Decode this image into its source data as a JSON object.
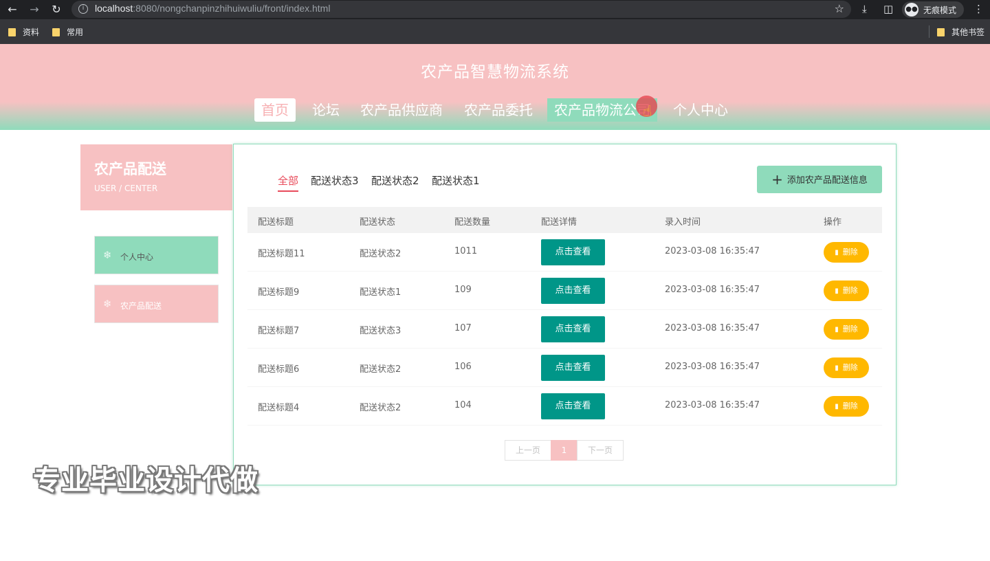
{
  "browser": {
    "url_host": "localhost",
    "url_rest": ":8080/nongchanpinzhihuiwuliu/front/index.html",
    "incognito_label": "无痕模式",
    "bookmarks": [
      "资料",
      "常用"
    ],
    "other_bookmarks": "其他书签"
  },
  "site": {
    "title": "农产品智慧物流系统",
    "nav": [
      "首页",
      "论坛",
      "农产品供应商",
      "农产品委托",
      "农产品物流公司",
      "个人中心"
    ]
  },
  "sidebar": {
    "title": "农产品配送",
    "subtitle": "USER / CENTER",
    "items": [
      "个人中心",
      "农产品配送"
    ]
  },
  "main": {
    "filters": [
      "全部",
      "配送状态3",
      "配送状态2",
      "配送状态1"
    ],
    "add_button": "添加农产品配送信息",
    "columns": [
      "配送标题",
      "配送状态",
      "配送数量",
      "配送详情",
      "录入时间",
      "操作"
    ],
    "rows": [
      {
        "title": "配送标题11",
        "status": "配送状态2",
        "qty": "1011",
        "view": "点击查看",
        "time": "2023-03-08 16:35:47",
        "del": "删除"
      },
      {
        "title": "配送标题9",
        "status": "配送状态1",
        "qty": "109",
        "view": "点击查看",
        "time": "2023-03-08 16:35:47",
        "del": "删除"
      },
      {
        "title": "配送标题7",
        "status": "配送状态3",
        "qty": "107",
        "view": "点击查看",
        "time": "2023-03-08 16:35:47",
        "del": "删除"
      },
      {
        "title": "配送标题6",
        "status": "配送状态2",
        "qty": "106",
        "view": "点击查看",
        "time": "2023-03-08 16:35:47",
        "del": "删除"
      },
      {
        "title": "配送标题4",
        "status": "配送状态2",
        "qty": "104",
        "view": "点击查看",
        "time": "2023-03-08 16:35:47",
        "del": "删除"
      }
    ],
    "pager": {
      "prev": "上一页",
      "current": "1",
      "next": "下一页"
    }
  },
  "watermark": "专业毕业设计代做",
  "colors": {
    "pink": "#f7c1c2",
    "mint": "#8fdbbb",
    "teal": "#009688",
    "amber": "#ffb800",
    "active_red": "#e84a5a"
  }
}
